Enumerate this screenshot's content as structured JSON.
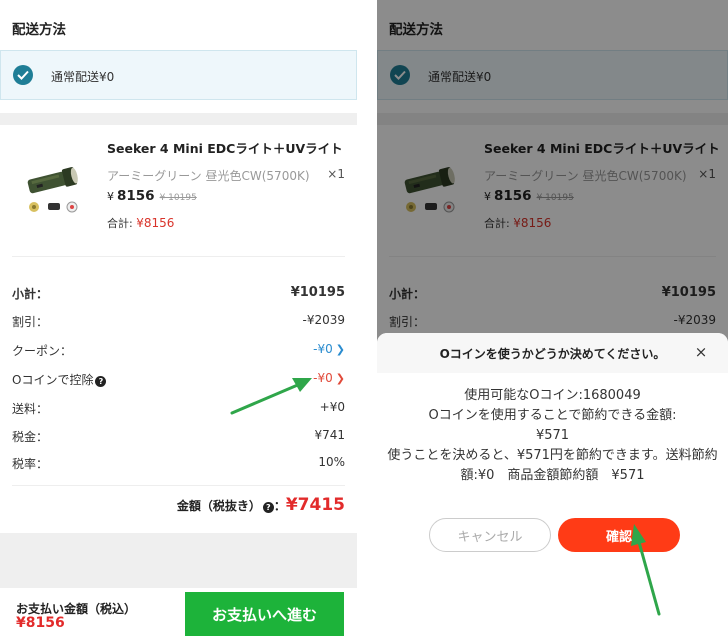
{
  "shipping": {
    "title": "配送方法",
    "option_label": "通常配送¥0"
  },
  "product": {
    "name": "Seeker 4 Mini EDCライト＋UVライト",
    "variant": "アーミーグリーン 昼光色CW(5700K)",
    "qty": "×1",
    "yen": "¥",
    "price": "8156",
    "orig_price": "¥ 10195",
    "total_label": "合計:",
    "total_value": "¥8156"
  },
  "summary": {
    "subtotal_label": "小計：",
    "subtotal_value": "¥10195",
    "discount_label": "割引：",
    "discount_value": "-¥2039",
    "coupon_label": "クーポン：",
    "coupon_value": "-¥0",
    "ocoin_label": "Oコインで控除",
    "ocoin_value": "-¥0",
    "shipping_label": "送料：",
    "shipping_value": "+¥0",
    "tax_label": "税金：",
    "tax_value": "¥741",
    "taxrate_label": "税率：",
    "taxrate_value": "10%",
    "grand_label": "金額（税抜き）",
    "grand_sep": "：",
    "grand_value": "¥7415"
  },
  "footer": {
    "pay_label": "お支払い金額（税込）",
    "pay_amount": "¥8156",
    "pay_button": "お支払いへ進む"
  },
  "modal": {
    "title": "Oコインを使うかどうか決めてください。",
    "close": "×",
    "line1": "使用可能なOコイン:1680049",
    "line2": "Oコインを使用することで節約できる金額:",
    "line3": "¥571",
    "line4": "使うことを決めると、¥571円を節約できます。送料節約額:¥0　商品金額節約額　¥571",
    "cancel": "キャンセル",
    "confirm": "確認"
  },
  "icons": {
    "check": "check-icon",
    "chevron": "chevron-right-icon",
    "help": "question-icon",
    "close": "close-icon"
  },
  "colors": {
    "accent_teal": "#1f7e96",
    "price_red": "#e22b2b",
    "pay_green": "#1db33a",
    "confirm_orange": "#ff3b16",
    "link_blue": "#2a8ccf",
    "annotation_green": "#2fa64a"
  }
}
